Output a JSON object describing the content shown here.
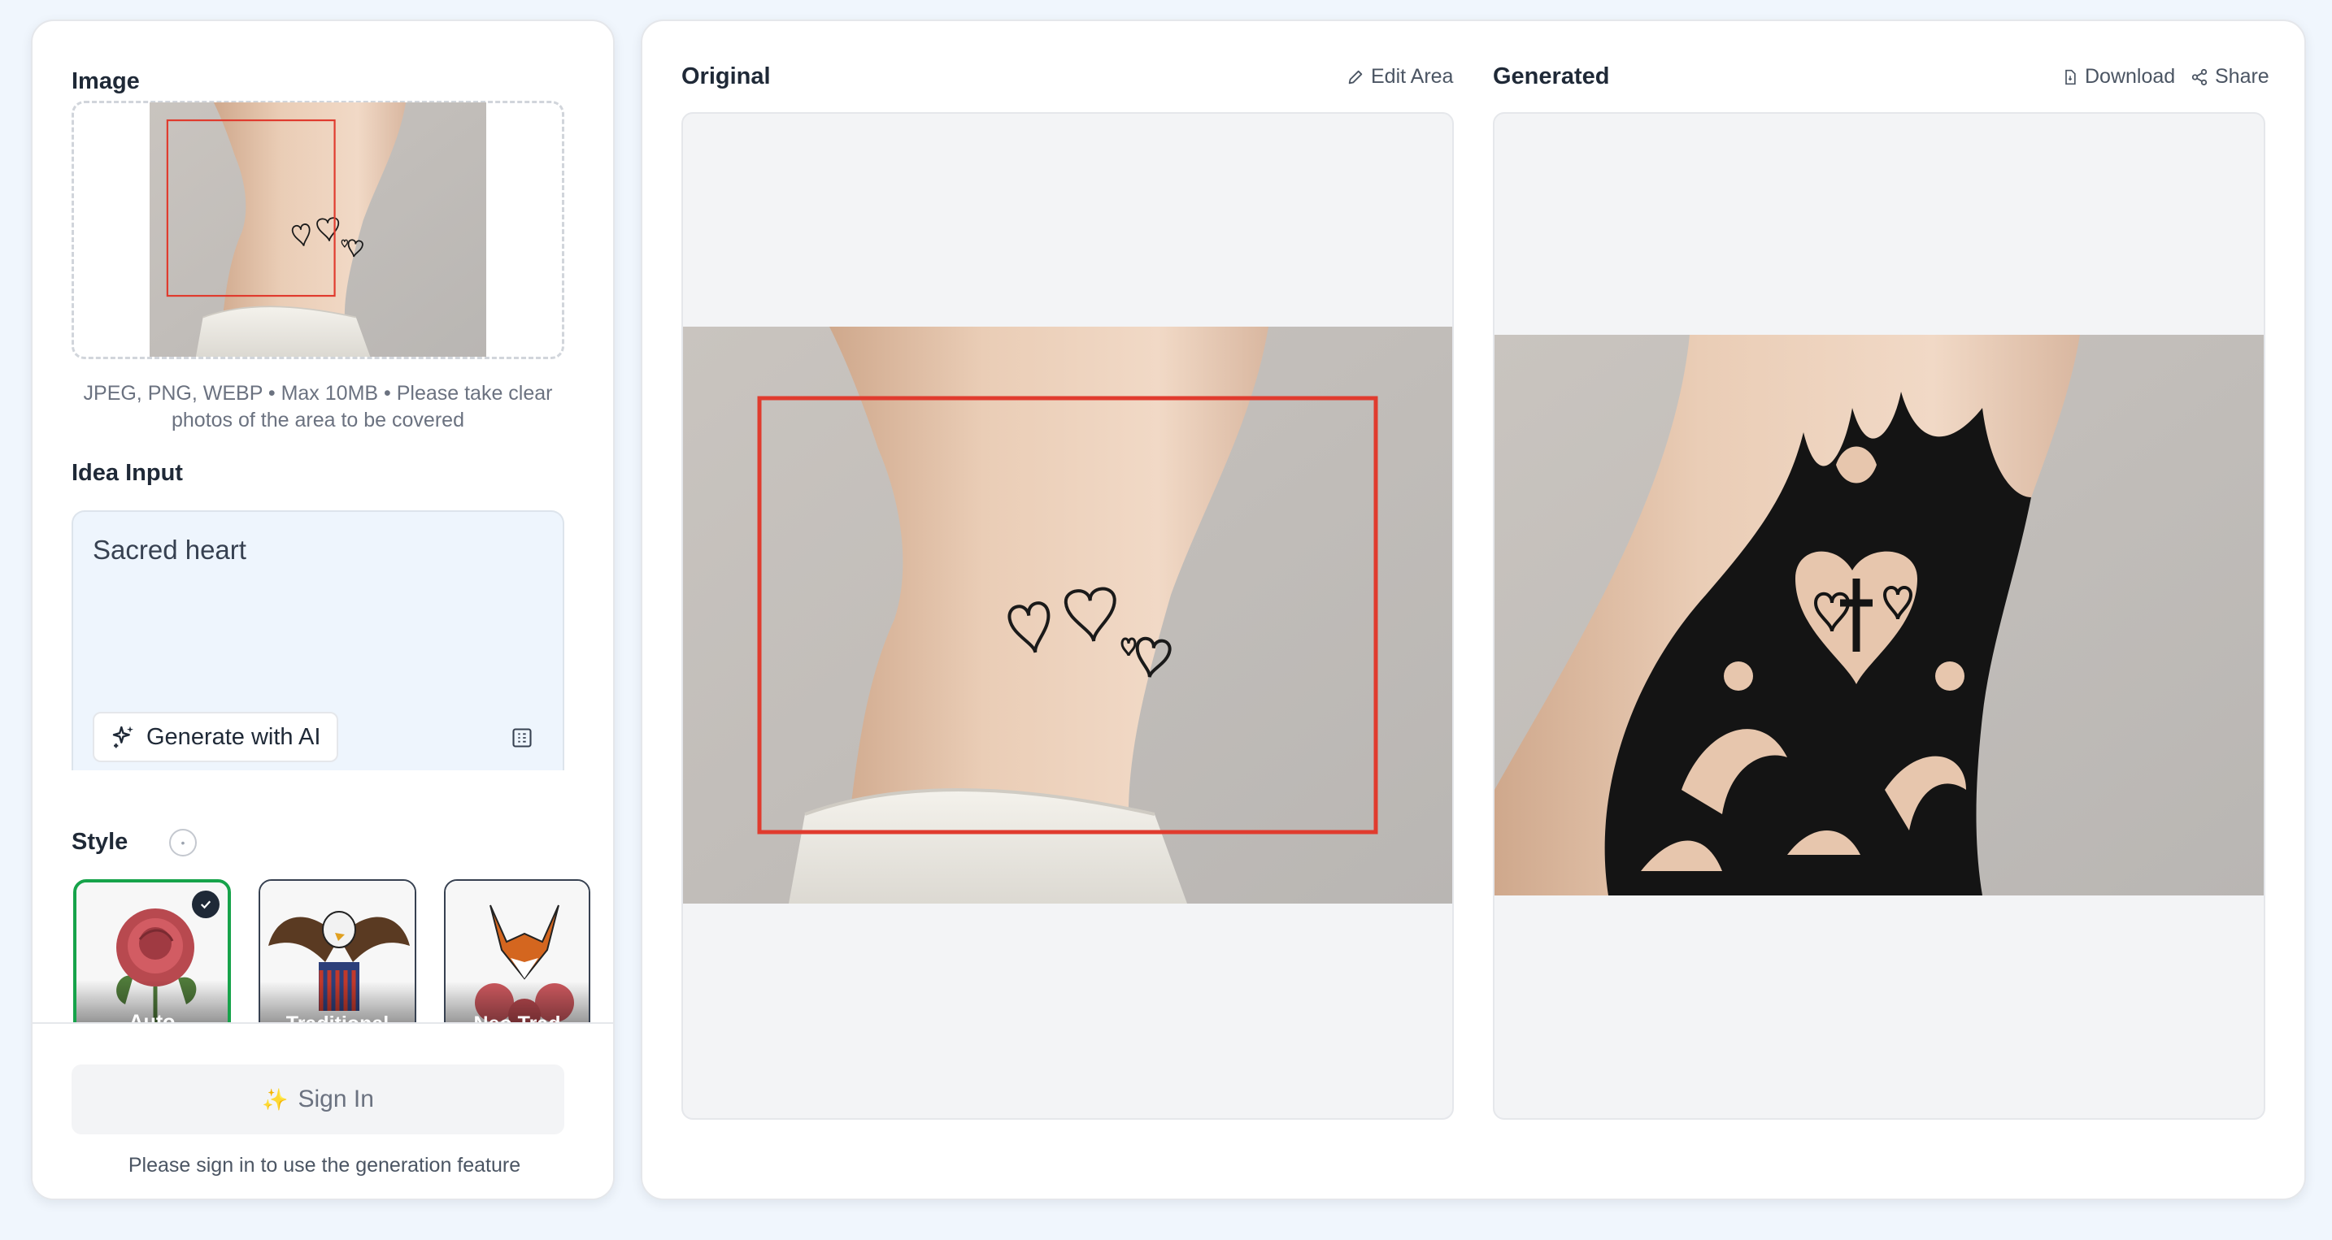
{
  "left": {
    "image_label": "Image",
    "upload_hint": "JPEG, PNG, WEBP • Max 10MB • Please take clear photos of the area to be covered",
    "idea_label": "Idea Input",
    "idea_value": "Sacred heart",
    "generate_ai_label": "Generate with AI",
    "style_label": "Style",
    "styles": [
      {
        "label": "Auto",
        "selected": true
      },
      {
        "label": "Traditional",
        "selected": false
      },
      {
        "label": "Neo Trad",
        "selected": false
      }
    ],
    "sign_in_label": "Sign In",
    "sign_in_hint": "Please sign in to use the generation feature"
  },
  "right": {
    "original_title": "Original",
    "edit_area_label": "Edit Area",
    "generated_title": "Generated",
    "download_label": "Download",
    "share_label": "Share"
  },
  "colors": {
    "page_bg": "#f0f6fd",
    "selection_box": "#e03b2e",
    "selected_style_border": "#16a34a",
    "idea_box_bg": "#eef5fd"
  },
  "icons": [
    "sparkles-icon",
    "template-icon",
    "info-icon",
    "check-icon",
    "pencil-icon",
    "file-icon",
    "share-icon"
  ]
}
